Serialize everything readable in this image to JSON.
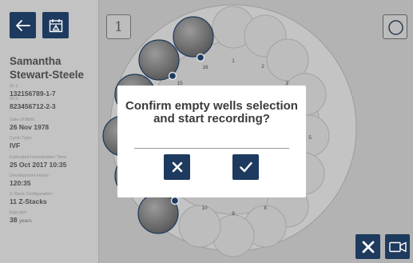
{
  "patient": {
    "first_name": "Samantha",
    "last_name": "Stewart-Steele",
    "id1_label": "ID 1:",
    "id1_value": "132156789-1-7",
    "id2_label": "ID 2:",
    "id2_value": "823456712-2-3",
    "dob_label": "Date of Birth:",
    "dob_value": "26 Nov 1978",
    "cycle_label": "Cycle Type:",
    "cycle_value": "IVF",
    "insemination_label": "Estimated Insemination Time:",
    "insemination_value": "25 Oct 2017 10:35",
    "dev_hours_label": "Development Hours:",
    "dev_hours_value": "120:35",
    "zstack_label": "Z-Stack Configuration:",
    "zstack_value": "11 Z-Stacks",
    "egg_age_label": "Egg age:",
    "egg_age_value": "38",
    "egg_age_unit": "years"
  },
  "slot": {
    "number": "1"
  },
  "dish": {
    "well_labels": [
      "1",
      "2",
      "3",
      "5",
      "8",
      "9",
      "10",
      "15",
      "16"
    ]
  },
  "dialog": {
    "title": "Confirm empty wells selection and start recording?"
  },
  "icons": {
    "back": "back-arrow-icon",
    "calendar": "calendar-icon",
    "circle": "circle-view-icon",
    "cancel": "close-icon",
    "confirm": "checkmark-icon",
    "camera": "video-camera-icon"
  },
  "colors": {
    "navy": "#1e3a5e",
    "well_selected": "#6d6d6d",
    "well_empty": "#bdbdbd",
    "dialog_bg": "#ffffff"
  }
}
